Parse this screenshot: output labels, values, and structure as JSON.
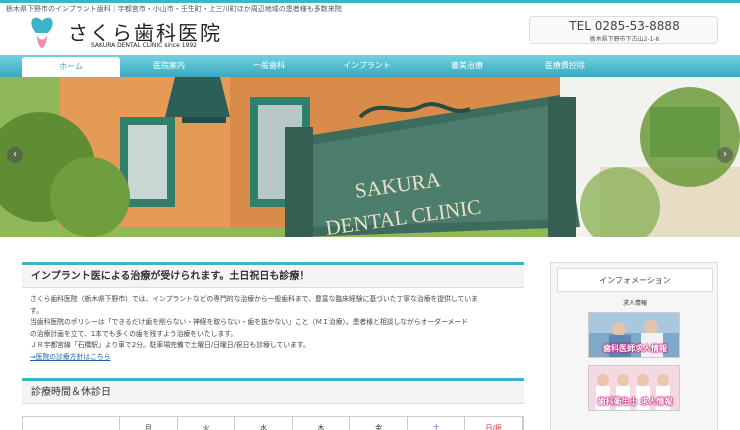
{
  "header": {
    "tagline": "栃木県下野市のインプラント歯科｜宇都宮市・小山市・壬生町・上三川町ほか周辺地域の患者様も多数来院",
    "clinic_name": "さくら歯科医院",
    "clinic_name_en": "SAKURA DENTAL CLINIC since 1992",
    "tel": "TEL 0285-53-8888",
    "address": "栃木県下野市下古山2-1-6"
  },
  "nav": {
    "items": [
      {
        "label": "ホーム"
      },
      {
        "label": "医院案内"
      },
      {
        "label": "一般歯科"
      },
      {
        "label": "インプラント"
      },
      {
        "label": "審美治療"
      },
      {
        "label": "医療費控除"
      }
    ]
  },
  "hero": {
    "sign_line1": "SAKURA",
    "sign_line2": "DENTAL CLINIC",
    "prev_arrow": "‹",
    "next_arrow": "›"
  },
  "intro": {
    "title": "インプラント医による治療が受けられます。土日祝日も診療！",
    "lines": [
      "さくら歯科医院（栃木県下野市）では、インプラントなどの専門的な治療から一般歯科まで、豊富な臨床経験に基づいた丁寧な治療を提供していま",
      "す。",
      "当歯科医院のポリシーは「できるだけ歯を削らない・神経を取らない・歯を抜かない」こと（ＭＩ治療）。患者様と相談しながらオーダーメード",
      "の治療計画を立て、1本でも多くの歯を残すよう治療をいたします。",
      "ＪＲ宇都宮線「石橋駅」より車で2分。駐車場完備で土曜日/日曜日/祝日も診療しています。"
    ],
    "link": "⇒医院の診療方針はこちら"
  },
  "hours": {
    "title": "診療時間＆休診日",
    "columns": [
      "",
      "月",
      "火",
      "水",
      "木",
      "金",
      "土",
      "日/祝"
    ]
  },
  "sidebar": {
    "title": "インフォメーション",
    "subtitle": "求人情報",
    "banners": [
      {
        "label": "歯科医師求人情報"
      },
      {
        "label": "歯科衛生士 求人情報"
      }
    ]
  },
  "colors": {
    "accent": "#3bb4c9",
    "banner_text": "#ffffff",
    "link": "#2260a8"
  }
}
